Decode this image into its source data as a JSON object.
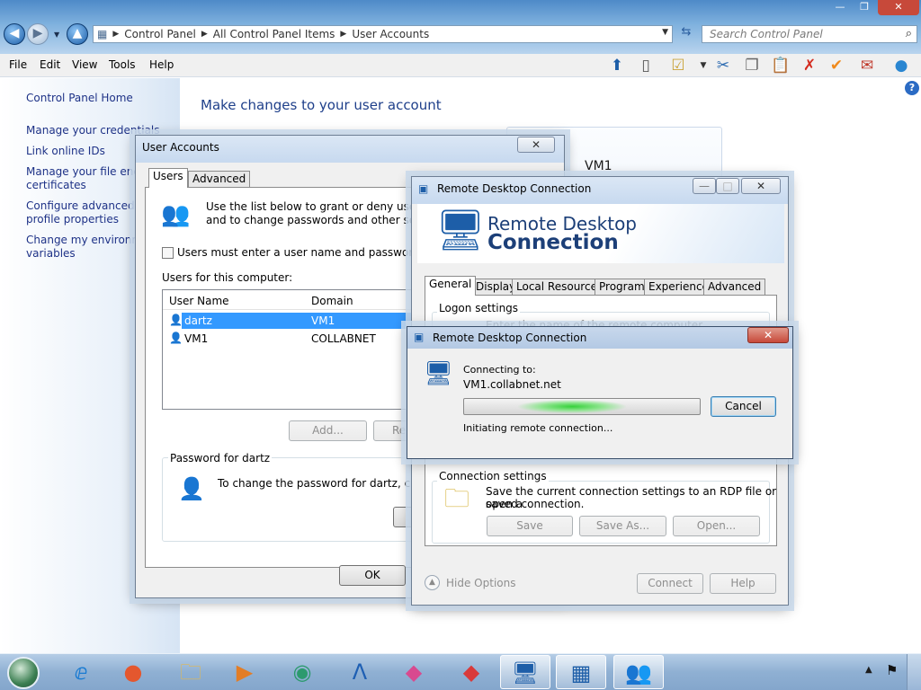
{
  "explorer": {
    "breadcrumb": [
      "Control Panel",
      "All Control Panel Items",
      "User Accounts"
    ],
    "search_placeholder": "Search Control Panel",
    "menu": [
      "File",
      "Edit",
      "View",
      "Tools",
      "Help"
    ],
    "sidebar": {
      "home": "Control Panel Home",
      "links": [
        "Manage your credentials",
        "Link online IDs",
        "Manage your file encry",
        "certificates",
        "Configure advanced us",
        "profile properties",
        "Change my environme",
        "variables"
      ]
    },
    "heading": "Make changes to your user account",
    "account_name": "VM1",
    "help_label": "?"
  },
  "user_accounts_dialog": {
    "title": "User Accounts",
    "close_label": "✕",
    "tabs": [
      "Users",
      "Advanced"
    ],
    "intro_line1": "Use the list below to grant or deny users acc",
    "intro_line2": "and to change passwords and other setting",
    "checkbox_label": "Users must enter a user name and password to us",
    "users_label": "Users for this computer:",
    "columns": [
      "User Name",
      "Domain"
    ],
    "rows": [
      {
        "name": "dartz",
        "domain": "VM1",
        "selected": true
      },
      {
        "name": "VM1",
        "domain": "COLLABNET",
        "selected": false
      }
    ],
    "add_button": "Add...",
    "remove_button_partial": "Re",
    "password_group": "Password for dartz",
    "password_text": "To change the password for dartz, click R",
    "ok_button": "OK"
  },
  "rdc_main": {
    "title": "Remote Desktop Connection",
    "min_label": "—",
    "max_label": "□",
    "close_label": "✕",
    "banner_line1": "Remote Desktop",
    "banner_line2": "Connection",
    "tabs": [
      "General",
      "Display",
      "Local Resources",
      "Programs",
      "Experience",
      "Advanced"
    ],
    "logon_group": "Logon settings",
    "logon_partial": "Enter the name of the remote computer",
    "connection_group": "Connection settings",
    "connection_text_line1": "Save the current connection settings to an RDP file or open a",
    "connection_text_line2": "saved connection.",
    "save_button": "Save",
    "save_as_button": "Save As...",
    "open_button": "Open...",
    "hide_options": "Hide Options",
    "connect_button": "Connect",
    "help_button": "Help"
  },
  "rdc_connecting": {
    "title": "Remote Desktop Connection",
    "close_label": "✕",
    "connecting_label": "Connecting to:",
    "host": "VM1.collabnet.net",
    "status": "Initiating remote connection...",
    "cancel_button": "Cancel"
  },
  "window_controls": {
    "min": "—",
    "max": "❐",
    "close": "✕"
  },
  "colors": {
    "link_blue": "#1e3287",
    "heading_blue": "#1e3f8a",
    "selection_blue": "#3399ff",
    "close_red": "#c7493a",
    "progress_green": "#35d13a"
  },
  "taskbar": {
    "apps": [
      "internet-explorer-icon",
      "firefox-icon",
      "file-explorer-icon",
      "media-player-icon",
      "app-icon",
      "arrow-app-icon",
      "fox-icon",
      "fox-red-icon",
      "remote-desktop-icon",
      "control-panel-icon",
      "user-accounts-icon"
    ]
  }
}
